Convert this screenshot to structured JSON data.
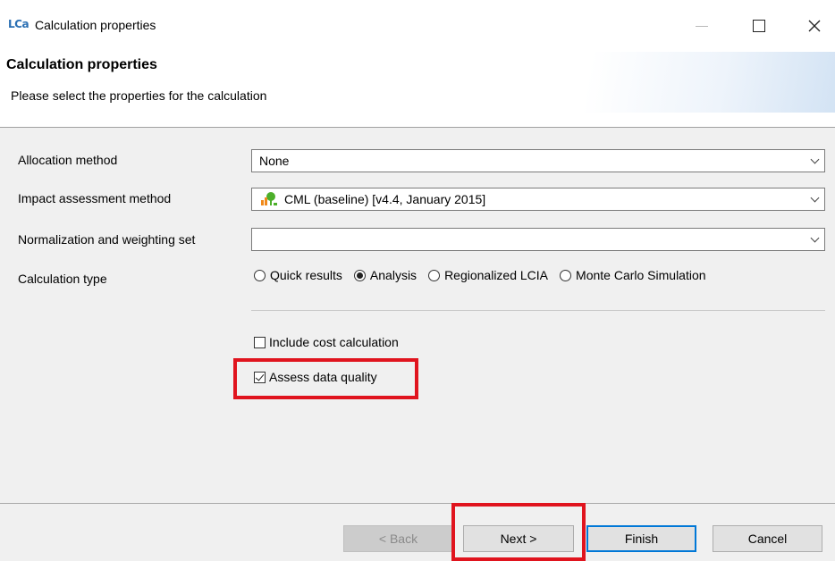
{
  "window": {
    "app_icon_text": "LCa",
    "title": "Calculation properties"
  },
  "header": {
    "title": "Calculation properties",
    "subtitle": "Please select the properties for the calculation"
  },
  "form": {
    "allocation": {
      "label": "Allocation method",
      "value": "None"
    },
    "impact": {
      "label": "Impact assessment method",
      "value": "CML (baseline) [v4.4, January 2015]",
      "icon": "impact-method-icon"
    },
    "normalization": {
      "label": "Normalization and weighting set",
      "value": ""
    },
    "calc_type": {
      "label": "Calculation type",
      "options": [
        "Quick results",
        "Analysis",
        "Regionalized LCIA",
        "Monte Carlo Simulation"
      ],
      "selected": "Analysis"
    },
    "include_cost": {
      "label": "Include cost calculation",
      "checked": false
    },
    "assess_quality": {
      "label": "Assess data quality",
      "checked": true
    }
  },
  "buttons": {
    "back": "< Back",
    "next": "Next >",
    "finish": "Finish",
    "cancel": "Cancel"
  },
  "colors": {
    "highlight": "#e0141e",
    "default_button_border": "#0078d7",
    "impact_icon_green": "#4caf2a",
    "impact_icon_orange": "#f08a1c"
  }
}
